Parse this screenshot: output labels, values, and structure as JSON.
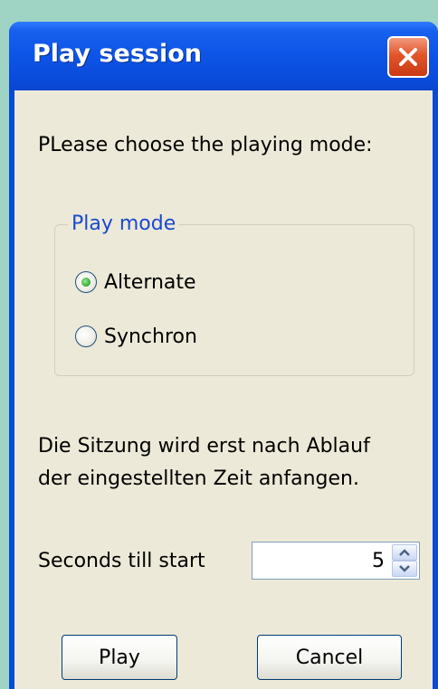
{
  "window": {
    "title": "Play session",
    "close_icon": "close-icon"
  },
  "prompt": "PLease choose the playing mode:",
  "play_mode": {
    "legend": "Play mode",
    "options": [
      {
        "label": "Alternate",
        "checked": true
      },
      {
        "label": "Synchron",
        "checked": false
      }
    ]
  },
  "info": {
    "line1": "Die Sitzung wird erst nach Ablauf",
    "line2": "der eingestellten Zeit anfangen."
  },
  "seconds": {
    "label": "Seconds till start",
    "value": "5"
  },
  "buttons": {
    "play": "Play",
    "cancel": "Cancel"
  },
  "colors": {
    "titlebar": "#0a4ad8",
    "client": "#ece9d8",
    "legend": "#1a49ce",
    "close": "#e2552b"
  }
}
